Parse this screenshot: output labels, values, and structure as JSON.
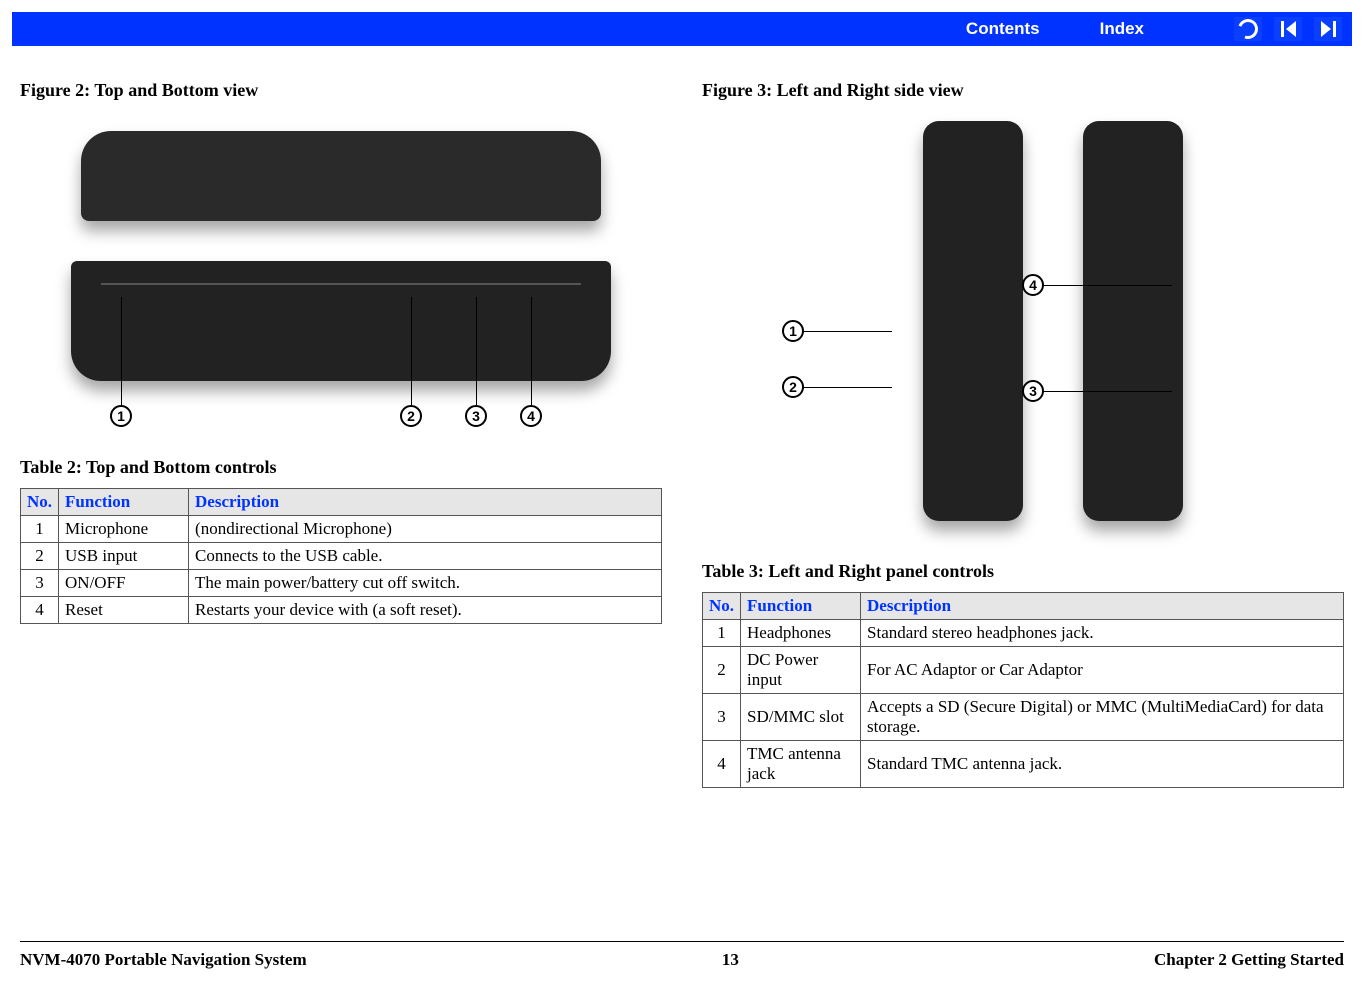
{
  "topbar": {
    "contents": "Contents",
    "index": "Index"
  },
  "left": {
    "fig_caption": "Figure 2: Top and Bottom view",
    "tbl_caption": "Table 2: Top and Bottom controls",
    "headers": {
      "no": "No.",
      "fn": "Function",
      "desc": "Description"
    },
    "rows": [
      {
        "no": "1",
        "fn": "Microphone",
        "desc": "(nondirectional Microphone)"
      },
      {
        "no": "2",
        "fn": "USB input",
        "desc": "Connects to the USB cable."
      },
      {
        "no": "3",
        "fn": "ON/OFF",
        "desc": "The main power/battery cut off switch."
      },
      {
        "no": "4",
        "fn": "Reset",
        "desc": "Restarts your device with (a soft reset)."
      }
    ],
    "callouts": [
      "1",
      "2",
      "3",
      "4"
    ]
  },
  "right": {
    "fig_caption": "Figure 3: Left and Right side view",
    "tbl_caption": "Table 3: Left and Right panel controls",
    "headers": {
      "no": "No.",
      "fn": "Function",
      "desc": "Description"
    },
    "rows": [
      {
        "no": "1",
        "fn": "Headphones",
        "desc": "Standard stereo headphones jack."
      },
      {
        "no": "2",
        "fn": "DC Power input",
        "desc": "For AC Adaptor or Car Adaptor"
      },
      {
        "no": "3",
        "fn": "SD/MMC slot",
        "desc": "Accepts a SD (Secure Digital) or MMC (MultiMediaCard) for data storage."
      },
      {
        "no": "4",
        "fn": "TMC antenna jack",
        "desc": "Standard TMC antenna jack."
      }
    ],
    "callouts": [
      "1",
      "2",
      "3",
      "4"
    ]
  },
  "footer": {
    "left": "NVM-4070 Portable Navigation System",
    "center": "13",
    "right": "Chapter 2 Getting Started"
  }
}
